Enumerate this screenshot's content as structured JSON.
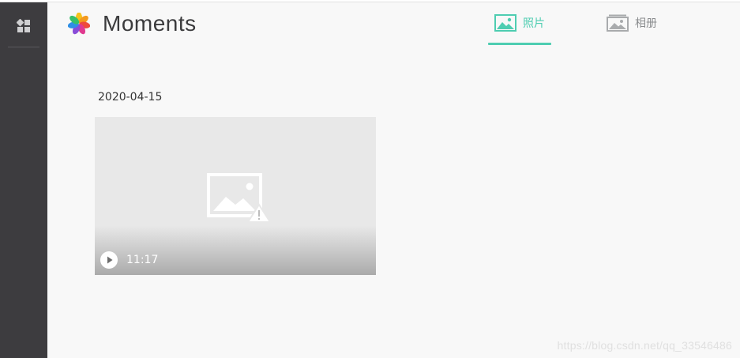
{
  "app": {
    "title": "Moments"
  },
  "tabs": [
    {
      "label": "照片",
      "icon": "photo-icon",
      "active": true
    },
    {
      "label": "相册",
      "icon": "albums-icon",
      "active": false
    }
  ],
  "moments": [
    {
      "date": "2020-04-15",
      "items": [
        {
          "type": "video",
          "duration": "11:17",
          "thumbnail": "broken-image-icon"
        }
      ]
    }
  ],
  "watermark": "https://blog.csdn.net/qq_33546486",
  "colors": {
    "accent": "#4ecdb1",
    "rail": "#3d3c3f",
    "background": "#f8f8f8",
    "thumb_bg": "#e8e8e8"
  }
}
